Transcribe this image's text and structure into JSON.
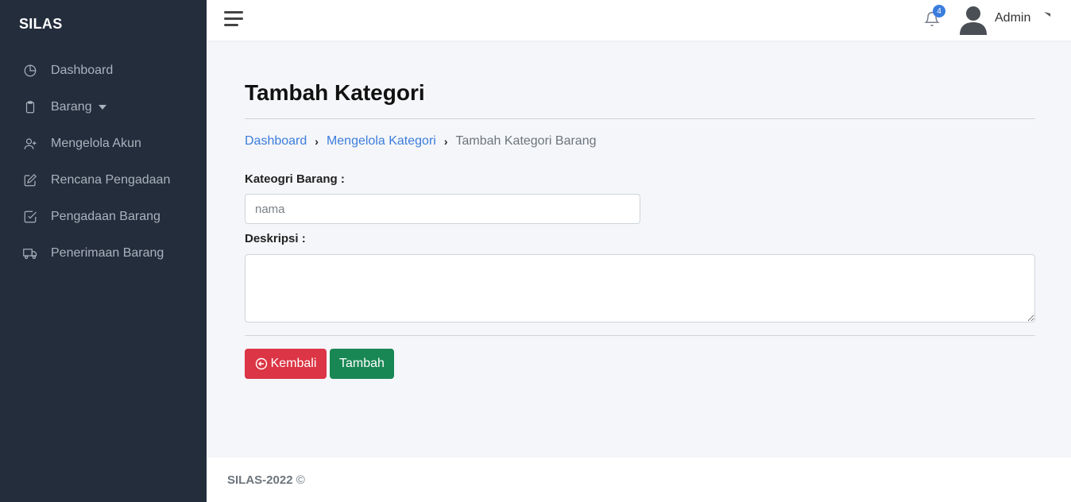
{
  "sidebar": {
    "brand": "SILAS",
    "items": [
      {
        "label": "Dashboard",
        "icon": "pie-chart-icon"
      },
      {
        "label": "Barang",
        "icon": "clipboard-icon"
      },
      {
        "label": "Mengelola Akun",
        "icon": "user-plus-icon"
      },
      {
        "label": "Rencana Pengadaan",
        "icon": "edit-icon"
      },
      {
        "label": "Pengadaan Barang",
        "icon": "check-square-icon"
      },
      {
        "label": "Penerimaan Barang",
        "icon": "truck-icon"
      }
    ]
  },
  "topbar": {
    "notification_count": "4",
    "user_name": "Admin"
  },
  "main": {
    "title": "Tambah Kategori",
    "breadcrumb": {
      "items": [
        "Dashboard",
        "Mengelola Kategori"
      ],
      "current": "Tambah Kategori Barang"
    },
    "form": {
      "category_label": "Kateogri Barang :",
      "category_placeholder": "nama",
      "category_value": "",
      "description_label": "Deskripsi :",
      "description_value": ""
    },
    "buttons": {
      "back": "Kembali",
      "add": "Tambah"
    }
  },
  "footer": {
    "text": "SILAS-2022",
    "copyright_symbol": "©"
  },
  "colors": {
    "sidebar_bg": "#232d3b",
    "accent": "#3b7ddd",
    "danger": "#dc3545",
    "success": "#198754"
  }
}
